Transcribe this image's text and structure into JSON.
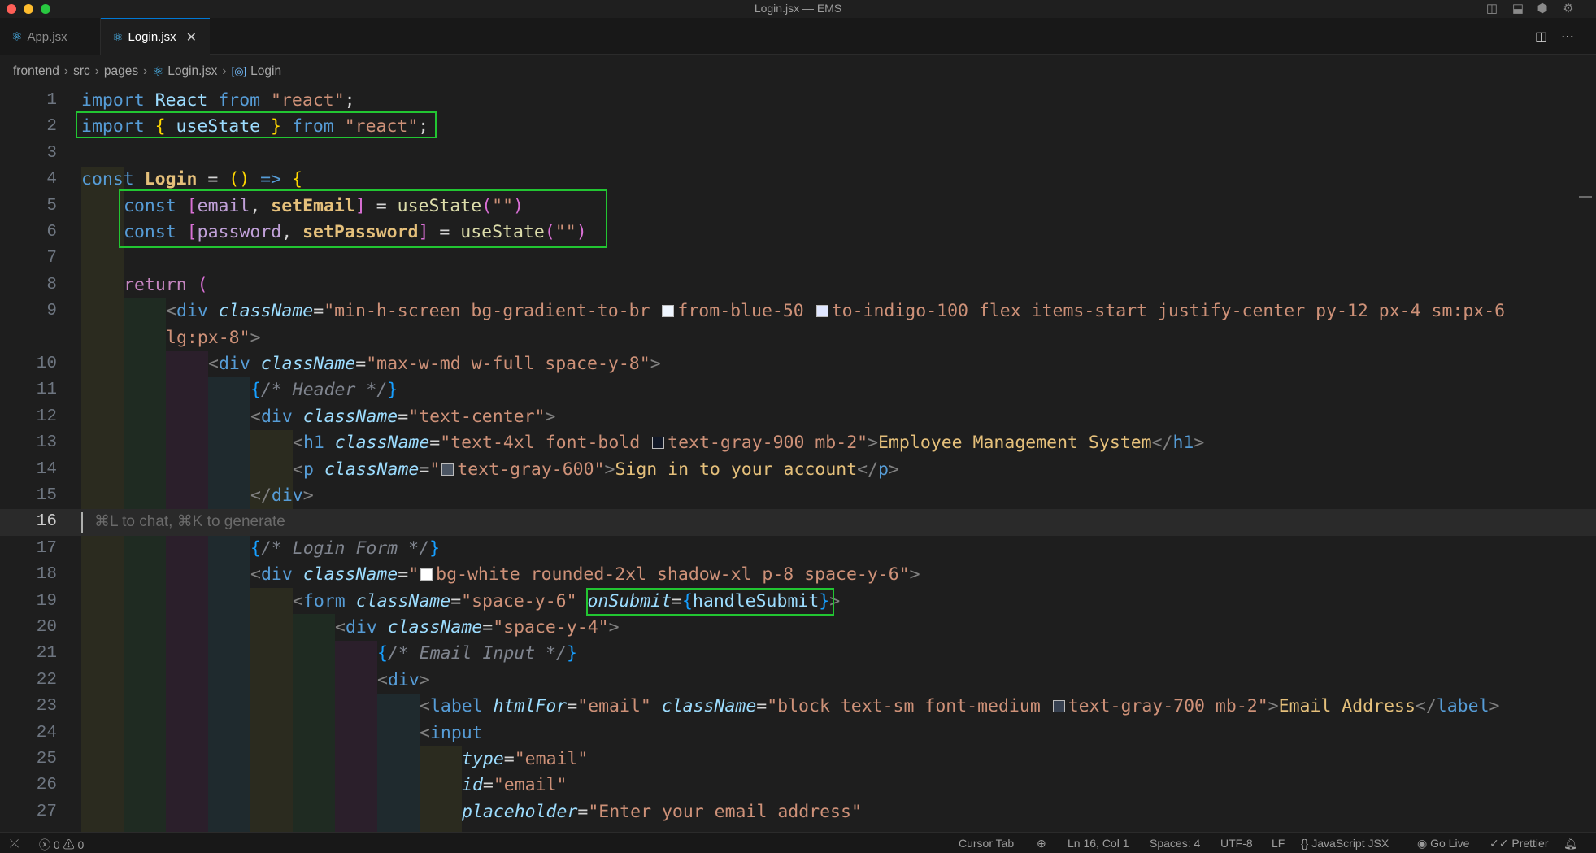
{
  "window": {
    "title": "Login.jsx — EMS"
  },
  "tabs": [
    {
      "label": "App.jsx",
      "active": false
    },
    {
      "label": "Login.jsx",
      "active": true
    }
  ],
  "breadcrumb": [
    "frontend",
    "src",
    "pages",
    "Login.jsx",
    "Login"
  ],
  "editor": {
    "inline_hint": "⌘L to chat, ⌘K to generate",
    "line_numbers": [
      "1",
      "2",
      "3",
      "4",
      "5",
      "6",
      "7",
      "8",
      "9",
      "10",
      "11",
      "12",
      "13",
      "14",
      "15",
      "16",
      "17",
      "18",
      "19",
      "20",
      "21",
      "22",
      "23",
      "24",
      "25",
      "26",
      "27"
    ],
    "lines": {
      "l1": [
        "import",
        " ",
        "React",
        " ",
        "from",
        " ",
        "\"react\"",
        ";"
      ],
      "l2": [
        "import",
        " ",
        "{",
        " ",
        "useState",
        " ",
        "}",
        " ",
        "from",
        " ",
        "\"react\"",
        ";"
      ],
      "l4": [
        "const",
        " ",
        "Login",
        " = ",
        "()",
        " ",
        "=>",
        " ",
        "{"
      ],
      "l5": [
        "const",
        " ",
        "[",
        "email",
        ", ",
        "setEmail",
        "]",
        " = ",
        "useState",
        "(",
        "\"\"",
        ")"
      ],
      "l6": [
        "const",
        " ",
        "[",
        "password",
        ", ",
        "setPassword",
        "]",
        " = ",
        "useState",
        "(",
        "\"\"",
        ")"
      ],
      "l8": [
        "return",
        " ",
        "("
      ],
      "l9a": [
        "<",
        "div",
        " ",
        "className",
        "=",
        "\"min-h-screen bg-gradient-to-br ",
        "from-blue-50 ",
        "to-indigo-100 flex items-start justify-center py-12 px-4 sm:px-6"
      ],
      "l9b": [
        "lg:px-8\"",
        ">"
      ],
      "l10": [
        "<",
        "div",
        " ",
        "className",
        "=",
        "\"max-w-md w-full space-y-8\"",
        ">"
      ],
      "l11": [
        "{",
        "/* Header */",
        "}"
      ],
      "l12": [
        "<",
        "div",
        " ",
        "className",
        "=",
        "\"text-center\"",
        ">"
      ],
      "l13": [
        "<",
        "h1",
        " ",
        "className",
        "=",
        "\"text-4xl font-bold ",
        "text-gray-900 mb-2\"",
        ">",
        "Employee Management System",
        "</",
        "h1",
        ">"
      ],
      "l14": [
        "<",
        "p",
        " ",
        "className",
        "=",
        "\"",
        "text-gray-600\"",
        ">",
        "Sign in to your account",
        "</",
        "p",
        ">"
      ],
      "l15": [
        "</",
        "div",
        ">"
      ],
      "l17": [
        "{",
        "/* Login Form */",
        "}"
      ],
      "l18": [
        "<",
        "div",
        " ",
        "className",
        "=",
        "\"",
        "bg-white rounded-2xl shadow-xl p-8 space-y-6\"",
        ">"
      ],
      "l19": [
        "<",
        "form",
        " ",
        "className",
        "=",
        "\"space-y-6\"",
        " ",
        "onSubmit",
        "=",
        "{",
        "handleSubmit",
        "}",
        ">"
      ],
      "l20": [
        "<",
        "div",
        " ",
        "className",
        "=",
        "\"space-y-4\"",
        ">"
      ],
      "l21": [
        "{",
        "/* Email Input */",
        "}"
      ],
      "l22": [
        "<",
        "div",
        ">"
      ],
      "l23": [
        "<",
        "label",
        " ",
        "htmlFor",
        "=",
        "\"email\"",
        " ",
        "className",
        "=",
        "\"block text-sm font-medium ",
        "text-gray-700 mb-2\"",
        ">",
        "Email Address",
        "</",
        "label",
        ">"
      ],
      "l24": [
        "<",
        "input"
      ],
      "l25": [
        "type",
        "=",
        "\"email\""
      ],
      "l26": [
        "id",
        "=",
        "\"email\""
      ],
      "l27": [
        "placeholder",
        "=",
        "\"Enter your email address\""
      ]
    }
  },
  "colors": {
    "swatch_from_blue_50": "#eff6ff",
    "swatch_to_indigo_100": "#e0e7ff",
    "swatch_text_gray_900": "#111827",
    "swatch_text_gray_600": "#4b5563",
    "swatch_bg_white": "#ffffff",
    "swatch_text_gray_700": "#374151",
    "highlight_box": "#22c532"
  },
  "statusbar": {
    "errors": "0",
    "warnings": "0",
    "cursor_tab": "Cursor Tab",
    "position": "Ln 16, Col 1",
    "spaces": "Spaces: 4",
    "encoding": "UTF-8",
    "eol": "LF",
    "language": "JavaScript JSX",
    "go_live": "Go Live",
    "prettier": "Prettier"
  }
}
